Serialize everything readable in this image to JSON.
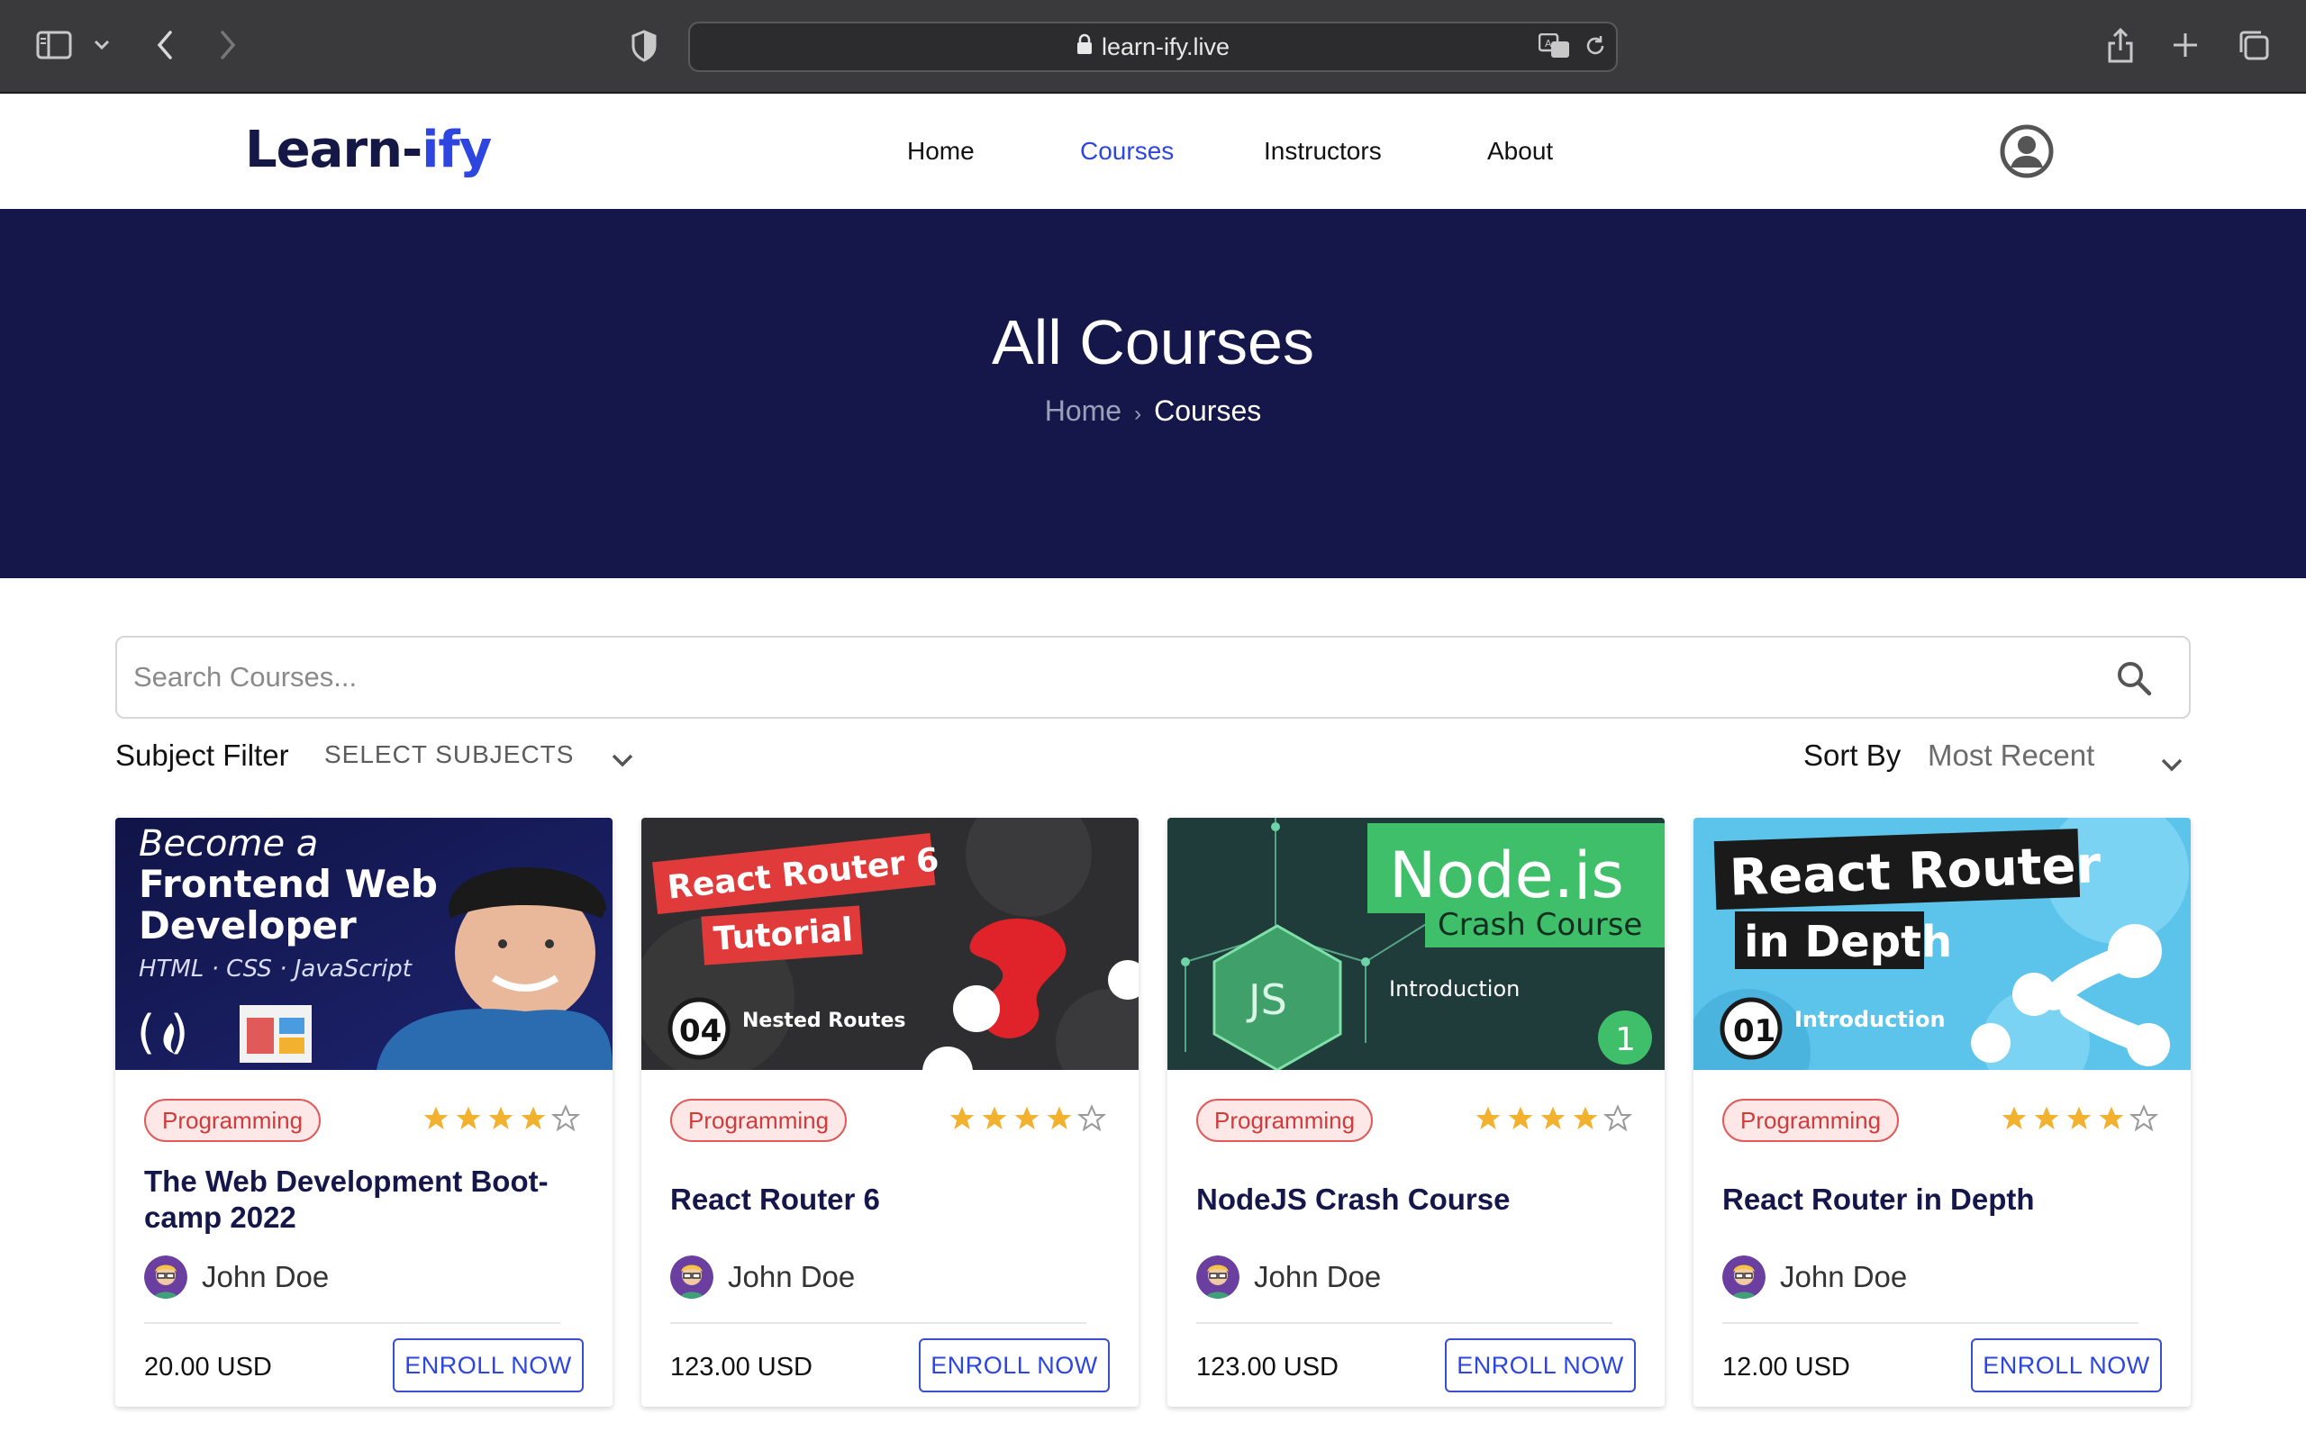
{
  "browser": {
    "url": "learn-ify.live"
  },
  "site": {
    "logo_main": "Learn-",
    "logo_accent": "ify",
    "nav": [
      {
        "label": "Home"
      },
      {
        "label": "Courses"
      },
      {
        "label": "Instructors"
      },
      {
        "label": "About"
      }
    ]
  },
  "hero": {
    "title": "All Courses",
    "breadcrumb_home": "Home",
    "breadcrumb_sep": "›",
    "breadcrumb_current": "Courses"
  },
  "search": {
    "placeholder": "Search Courses..."
  },
  "filters": {
    "subject_label": "Subject Filter",
    "subject_value": "SELECT SUBJECTS",
    "sort_label": "Sort By",
    "sort_value": "Most Recent"
  },
  "colors": {
    "brand_navy": "#15174a",
    "accent_blue": "#2d46e0",
    "tag_red": "#d33a3a",
    "star_gold": "#f2b230"
  },
  "courses": [
    {
      "thumb_lines": [
        "Become a",
        "Frontend Web",
        "Developer",
        "HTML · CSS · JavaScript"
      ],
      "category": "Programming",
      "rating": 4,
      "title": "The Web Development Boot-camp 2022",
      "author": "John Doe",
      "price": "20.00 USD",
      "cta": "ENROLL NOW"
    },
    {
      "thumb_lines": [
        "React Router 6",
        "Tutorial",
        "04",
        "Nested Routes"
      ],
      "category": "Programming",
      "rating": 4,
      "title": "React Router 6",
      "author": "John Doe",
      "price": "123.00 USD",
      "cta": "ENROLL NOW"
    },
    {
      "thumb_lines": [
        "Node.js",
        "Crash Course",
        "JS",
        "Introduction",
        "1"
      ],
      "category": "Programming",
      "rating": 4,
      "title": "NodeJS Crash Course",
      "author": "John Doe",
      "price": "123.00 USD",
      "cta": "ENROLL NOW"
    },
    {
      "thumb_lines": [
        "React Router",
        "in Depth",
        "01",
        "Introduction"
      ],
      "category": "Programming",
      "rating": 4,
      "title": "React Router in Depth",
      "author": "John Doe",
      "price": "12.00 USD",
      "cta": "ENROLL NOW"
    }
  ]
}
